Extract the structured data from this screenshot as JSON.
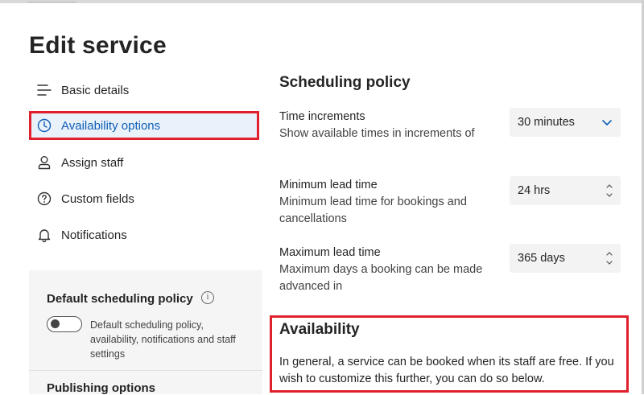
{
  "page": {
    "title": "Edit service"
  },
  "nav": {
    "items": [
      {
        "label": "Basic details",
        "icon": "list-lines-icon",
        "active": false
      },
      {
        "label": "Availability options",
        "icon": "clock-icon",
        "active": true
      },
      {
        "label": "Assign staff",
        "icon": "person-icon",
        "active": false
      },
      {
        "label": "Custom fields",
        "icon": "question-circle-icon",
        "active": false
      },
      {
        "label": "Notifications",
        "icon": "bell-icon",
        "active": false
      }
    ]
  },
  "left_card": {
    "default_policy_title": "Default scheduling policy",
    "default_policy_toggle": {
      "on": false
    },
    "default_policy_desc": "Default scheduling policy, availability, notifications and staff settings",
    "publishing_title": "Publishing options"
  },
  "scheduling": {
    "title": "Scheduling policy",
    "time_increments": {
      "label": "Time increments",
      "desc": "Show available times in increments of",
      "value": "30 minutes"
    },
    "min_lead": {
      "label": "Minimum lead time",
      "desc": "Minimum lead time for bookings and cancellations",
      "value": "24 hrs"
    },
    "max_lead": {
      "label": "Maximum lead time",
      "desc": "Maximum days a booking can be made advanced in",
      "value": "365 days"
    }
  },
  "availability": {
    "title": "Availability",
    "text": "In general, a service can be booked when its staff are free. If you wish to customize this further, you can do so below."
  },
  "colors": {
    "highlight": "#e0202c",
    "accent": "#0f5fb5",
    "active_bg": "#e9f1fb"
  }
}
